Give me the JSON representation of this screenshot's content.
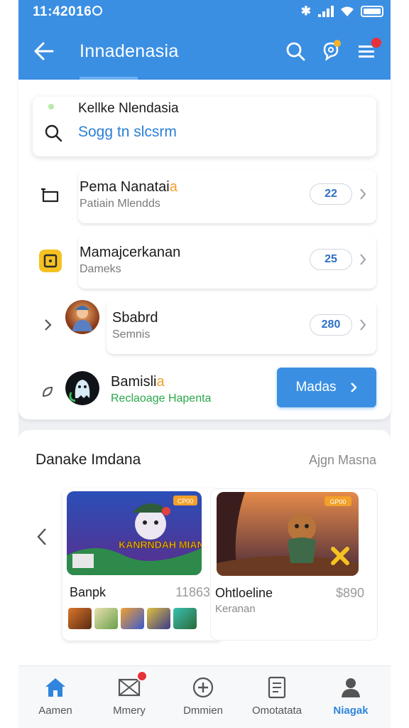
{
  "status_bar": {
    "time": "11:42016"
  },
  "app_bar": {
    "title": "Innadenasia"
  },
  "search": {
    "label": "Kellke Nlendasia",
    "value": "Sogg tn slcsrm"
  },
  "list": [
    {
      "title": "Pema Nanatai",
      "title_accent": "a",
      "subtitle": "Patiain Mlendds",
      "count": "22",
      "icon": "folder-tab-icon"
    },
    {
      "title": "Mamajcerkanan",
      "subtitle": "Dameks",
      "count": "25",
      "icon": "square-badge-icon"
    },
    {
      "title": "Sbabrd",
      "subtitle": "Semnis",
      "count": "280",
      "icon": "game-avatar"
    },
    {
      "title": "Bamisli",
      "title_accent": "a",
      "subtitle": "Reclaoage Hapenta",
      "action_label": "Madas",
      "icon": "ghost-avatar"
    }
  ],
  "section": {
    "title": "Danake Imdana",
    "link": "Ajgn Masna",
    "games": [
      {
        "name": "Banpk",
        "price": "11863",
        "art_text": "KANRNDAH MIANIS",
        "badge": "CP00"
      },
      {
        "name": "Ohtloeline",
        "price": "$890",
        "subtitle": "Keranan",
        "badge": "GP00"
      }
    ]
  },
  "bottom_nav": [
    {
      "label": "Aamen",
      "icon": "home-icon",
      "active": false
    },
    {
      "label": "Mmery",
      "icon": "mail-icon",
      "active": false
    },
    {
      "label": "Dmmien",
      "icon": "plus-circle-icon",
      "active": false
    },
    {
      "label": "Omotatata",
      "icon": "document-icon",
      "active": false
    },
    {
      "label": "Niagak",
      "icon": "profile-icon",
      "active": true
    }
  ],
  "colors": {
    "primary": "#3b8fe3",
    "accent_orange": "#f2a02a",
    "accent_green": "#2aa84a",
    "badge_red": "#e7323a"
  }
}
